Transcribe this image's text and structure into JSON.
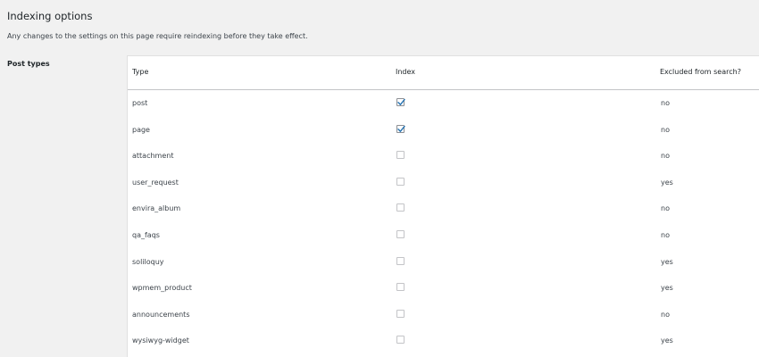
{
  "header": {
    "title": "Indexing options",
    "description": "Any changes to the settings on this page require reindexing before they take effect."
  },
  "section": {
    "label": "Post types"
  },
  "table": {
    "columns": [
      "Type",
      "Index",
      "Excluded from search?"
    ],
    "rows": [
      {
        "type": "post",
        "index": true,
        "excluded": "no"
      },
      {
        "type": "page",
        "index": true,
        "excluded": "no"
      },
      {
        "type": "attachment",
        "index": false,
        "excluded": "no"
      },
      {
        "type": "user_request",
        "index": false,
        "excluded": "yes"
      },
      {
        "type": "envira_album",
        "index": false,
        "excluded": "no"
      },
      {
        "type": "qa_faqs",
        "index": false,
        "excluded": "no"
      },
      {
        "type": "soliloquy",
        "index": false,
        "excluded": "yes"
      },
      {
        "type": "wpmem_product",
        "index": false,
        "excluded": "yes"
      },
      {
        "type": "announcements",
        "index": false,
        "excluded": "no"
      },
      {
        "type": "wysiwyg-widget",
        "index": false,
        "excluded": "yes"
      }
    ]
  },
  "colors": {
    "checkmark": "#2271b1",
    "background": "#f1f1f1",
    "panel": "#ffffff"
  }
}
